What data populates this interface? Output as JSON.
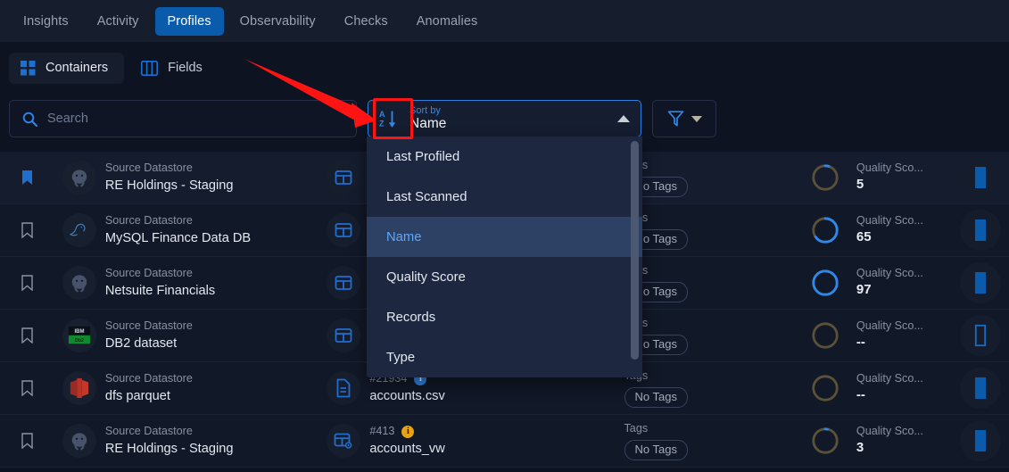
{
  "topnav": {
    "tabs": [
      {
        "label": "Insights",
        "active": false
      },
      {
        "label": "Activity",
        "active": false
      },
      {
        "label": "Profiles",
        "active": true
      },
      {
        "label": "Observability",
        "active": false
      },
      {
        "label": "Checks",
        "active": false
      },
      {
        "label": "Anomalies",
        "active": false
      }
    ],
    "active_color": "#0a5bab"
  },
  "viewtoggle": {
    "containers_label": "Containers",
    "fields_label": "Fields",
    "active": "Containers"
  },
  "search": {
    "placeholder": "Search",
    "value": "",
    "icon": "search-icon"
  },
  "sort": {
    "label": "Sort by",
    "value": "Name",
    "icon": "sort-alpha-down-icon",
    "expanded": true,
    "options": [
      {
        "label": "Last Profiled",
        "selected": false
      },
      {
        "label": "Last Scanned",
        "selected": false
      },
      {
        "label": "Name",
        "selected": true
      },
      {
        "label": "Quality Score",
        "selected": false
      },
      {
        "label": "Records",
        "selected": false
      },
      {
        "label": "Type",
        "selected": false
      }
    ],
    "accent_color": "#2f87ee",
    "highlight_box_color": "#ff1414"
  },
  "filter": {
    "icon": "funnel-icon",
    "caret": "chevron-down-icon"
  },
  "columns": {
    "source_label": "Source Datastore",
    "tags_label": "Tags",
    "no_tags_label": "No Tags",
    "quality_score_label": "Quality Sco..."
  },
  "rows": [
    {
      "bookmarked": true,
      "logo": "postgresql-logo",
      "source_label": "Source Datastore",
      "datastore": "RE Holdings - Staging",
      "type_icon": "table-icon",
      "object_id": "",
      "object_name": "",
      "info_badge": "",
      "tags_label": "Tags",
      "tags_value": "No Tags",
      "score_label": "Quality Sco...",
      "score_value": "5",
      "score_pct": 5,
      "bar_filled": true
    },
    {
      "bookmarked": false,
      "logo": "mysql-logo",
      "source_label": "Source Datastore",
      "datastore": "MySQL Finance Data DB",
      "type_icon": "table-icon",
      "object_id": "",
      "object_name": "",
      "info_badge": "",
      "tags_label": "Tags",
      "tags_value": "No Tags",
      "score_label": "Quality Sco...",
      "score_value": "65",
      "score_pct": 65,
      "bar_filled": true
    },
    {
      "bookmarked": false,
      "logo": "postgresql-logo",
      "source_label": "Source Datastore",
      "datastore": "Netsuite Financials",
      "type_icon": "table-icon",
      "object_id": "",
      "object_name": "",
      "info_badge": "",
      "tags_label": "Tags",
      "tags_value": "No Tags",
      "score_label": "Quality Sco...",
      "score_value": "97",
      "score_pct": 97,
      "bar_filled": true
    },
    {
      "bookmarked": false,
      "logo": "db2-logo",
      "source_label": "Source Datastore",
      "datastore": "DB2 dataset",
      "type_icon": "table-icon",
      "object_id": "",
      "object_name": "",
      "info_badge": "",
      "tags_label": "Tags",
      "tags_value": "No Tags",
      "score_label": "Quality Sco...",
      "score_value": "--",
      "score_pct": 0,
      "bar_filled": false
    },
    {
      "bookmarked": false,
      "logo": "redshift-logo",
      "source_label": "Source Datastore",
      "datastore": "dfs parquet",
      "type_icon": "file-icon",
      "object_id": "#21934",
      "object_name": "accounts.csv",
      "info_badge": "info-blue",
      "tags_label": "Tags",
      "tags_value": "No Tags",
      "score_label": "Quality Sco...",
      "score_value": "--",
      "score_pct": 0,
      "bar_filled": true
    },
    {
      "bookmarked": false,
      "logo": "postgresql-logo",
      "source_label": "Source Datastore",
      "datastore": "RE Holdings - Staging",
      "type_icon": "view-table-icon",
      "object_id": "#413",
      "object_name": "accounts_vw",
      "info_badge": "info-amber",
      "tags_label": "Tags",
      "tags_value": "No Tags",
      "score_label": "Quality Sco...",
      "score_value": "3",
      "score_pct": 3,
      "bar_filled": true
    }
  ],
  "annotation": {
    "type": "red-arrow",
    "color": "#ff1414",
    "points_to": "sort-by-icon"
  }
}
